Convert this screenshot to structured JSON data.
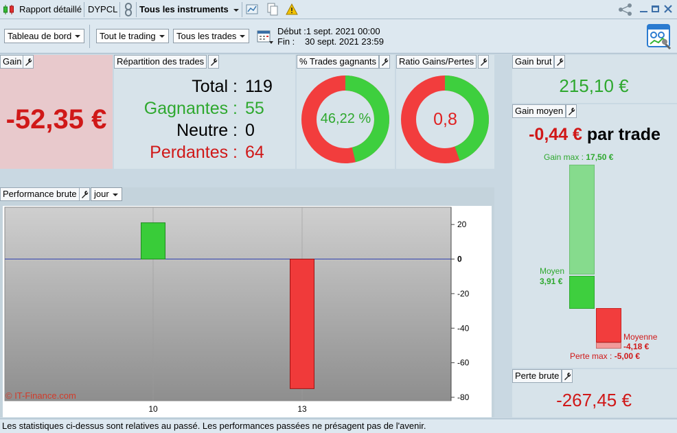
{
  "titlebar": {
    "report": "Rapport détaillé",
    "symbol": "DYPCL",
    "instruments": "Tous les instruments"
  },
  "toolbar": {
    "dashboard": "Tableau de bord",
    "trading": "Tout le trading",
    "trades": "Tous les trades",
    "start_label": "Début :",
    "start_value": "1 sept. 2021 00:00",
    "end_label": "Fin :",
    "end_value": "30 sept. 2021 23:59"
  },
  "gain": {
    "label": "Gain",
    "value": "-52,35 €"
  },
  "repartition": {
    "label": "Répartition des trades",
    "total_label": "Total :",
    "total": "119",
    "win_label": "Gagnantes :",
    "win": "55",
    "neutral_label": "Neutre :",
    "neutral": "0",
    "loss_label": "Perdantes :",
    "loss": "64"
  },
  "pct_winning": {
    "label": "% Trades gagnants",
    "value": "46,22 %",
    "fraction": 0.4622
  },
  "ratio": {
    "label": "Ratio Gains/Pertes",
    "value": "0,8",
    "fraction": 0.4444
  },
  "gross_gain": {
    "label": "Gain brut",
    "value": "215,10 €"
  },
  "avg_gain": {
    "label": "Gain moyen",
    "value": "-0,44 €",
    "suffix": "par trade",
    "max_gain_label": "Gain max :",
    "max_gain": "17,50 €",
    "avg_win_label": "Moyen",
    "avg_win": "3,91 €",
    "avg_loss_label": "Moyenne",
    "avg_loss": "-4,18 €",
    "max_loss_label": "Perte max :",
    "max_loss": "-5,00 €"
  },
  "gross_loss": {
    "label": "Perte brute",
    "value": "-267,45 €"
  },
  "performance": {
    "label": "Performance brute",
    "period": "jour",
    "watermark": "© IT-Finance.com"
  },
  "chart_data": {
    "type": "bar",
    "categories": [
      "10",
      "13"
    ],
    "values": [
      21,
      -75
    ],
    "ylim": [
      -82,
      30
    ],
    "yticks": [
      20,
      0,
      -20,
      -40,
      -60,
      -80
    ],
    "colors": {
      "positive": "#39cc39",
      "negative": "#f03a3a"
    }
  },
  "footer": {
    "disclaimer": "Les statistiques ci-dessus sont relatives au passé. Les performances passées ne présagent pas de l'avenir."
  },
  "colors": {
    "win": "#3ecf3e",
    "loss": "#f23d3d",
    "gain_panel_bg": "#e8c9cc"
  }
}
